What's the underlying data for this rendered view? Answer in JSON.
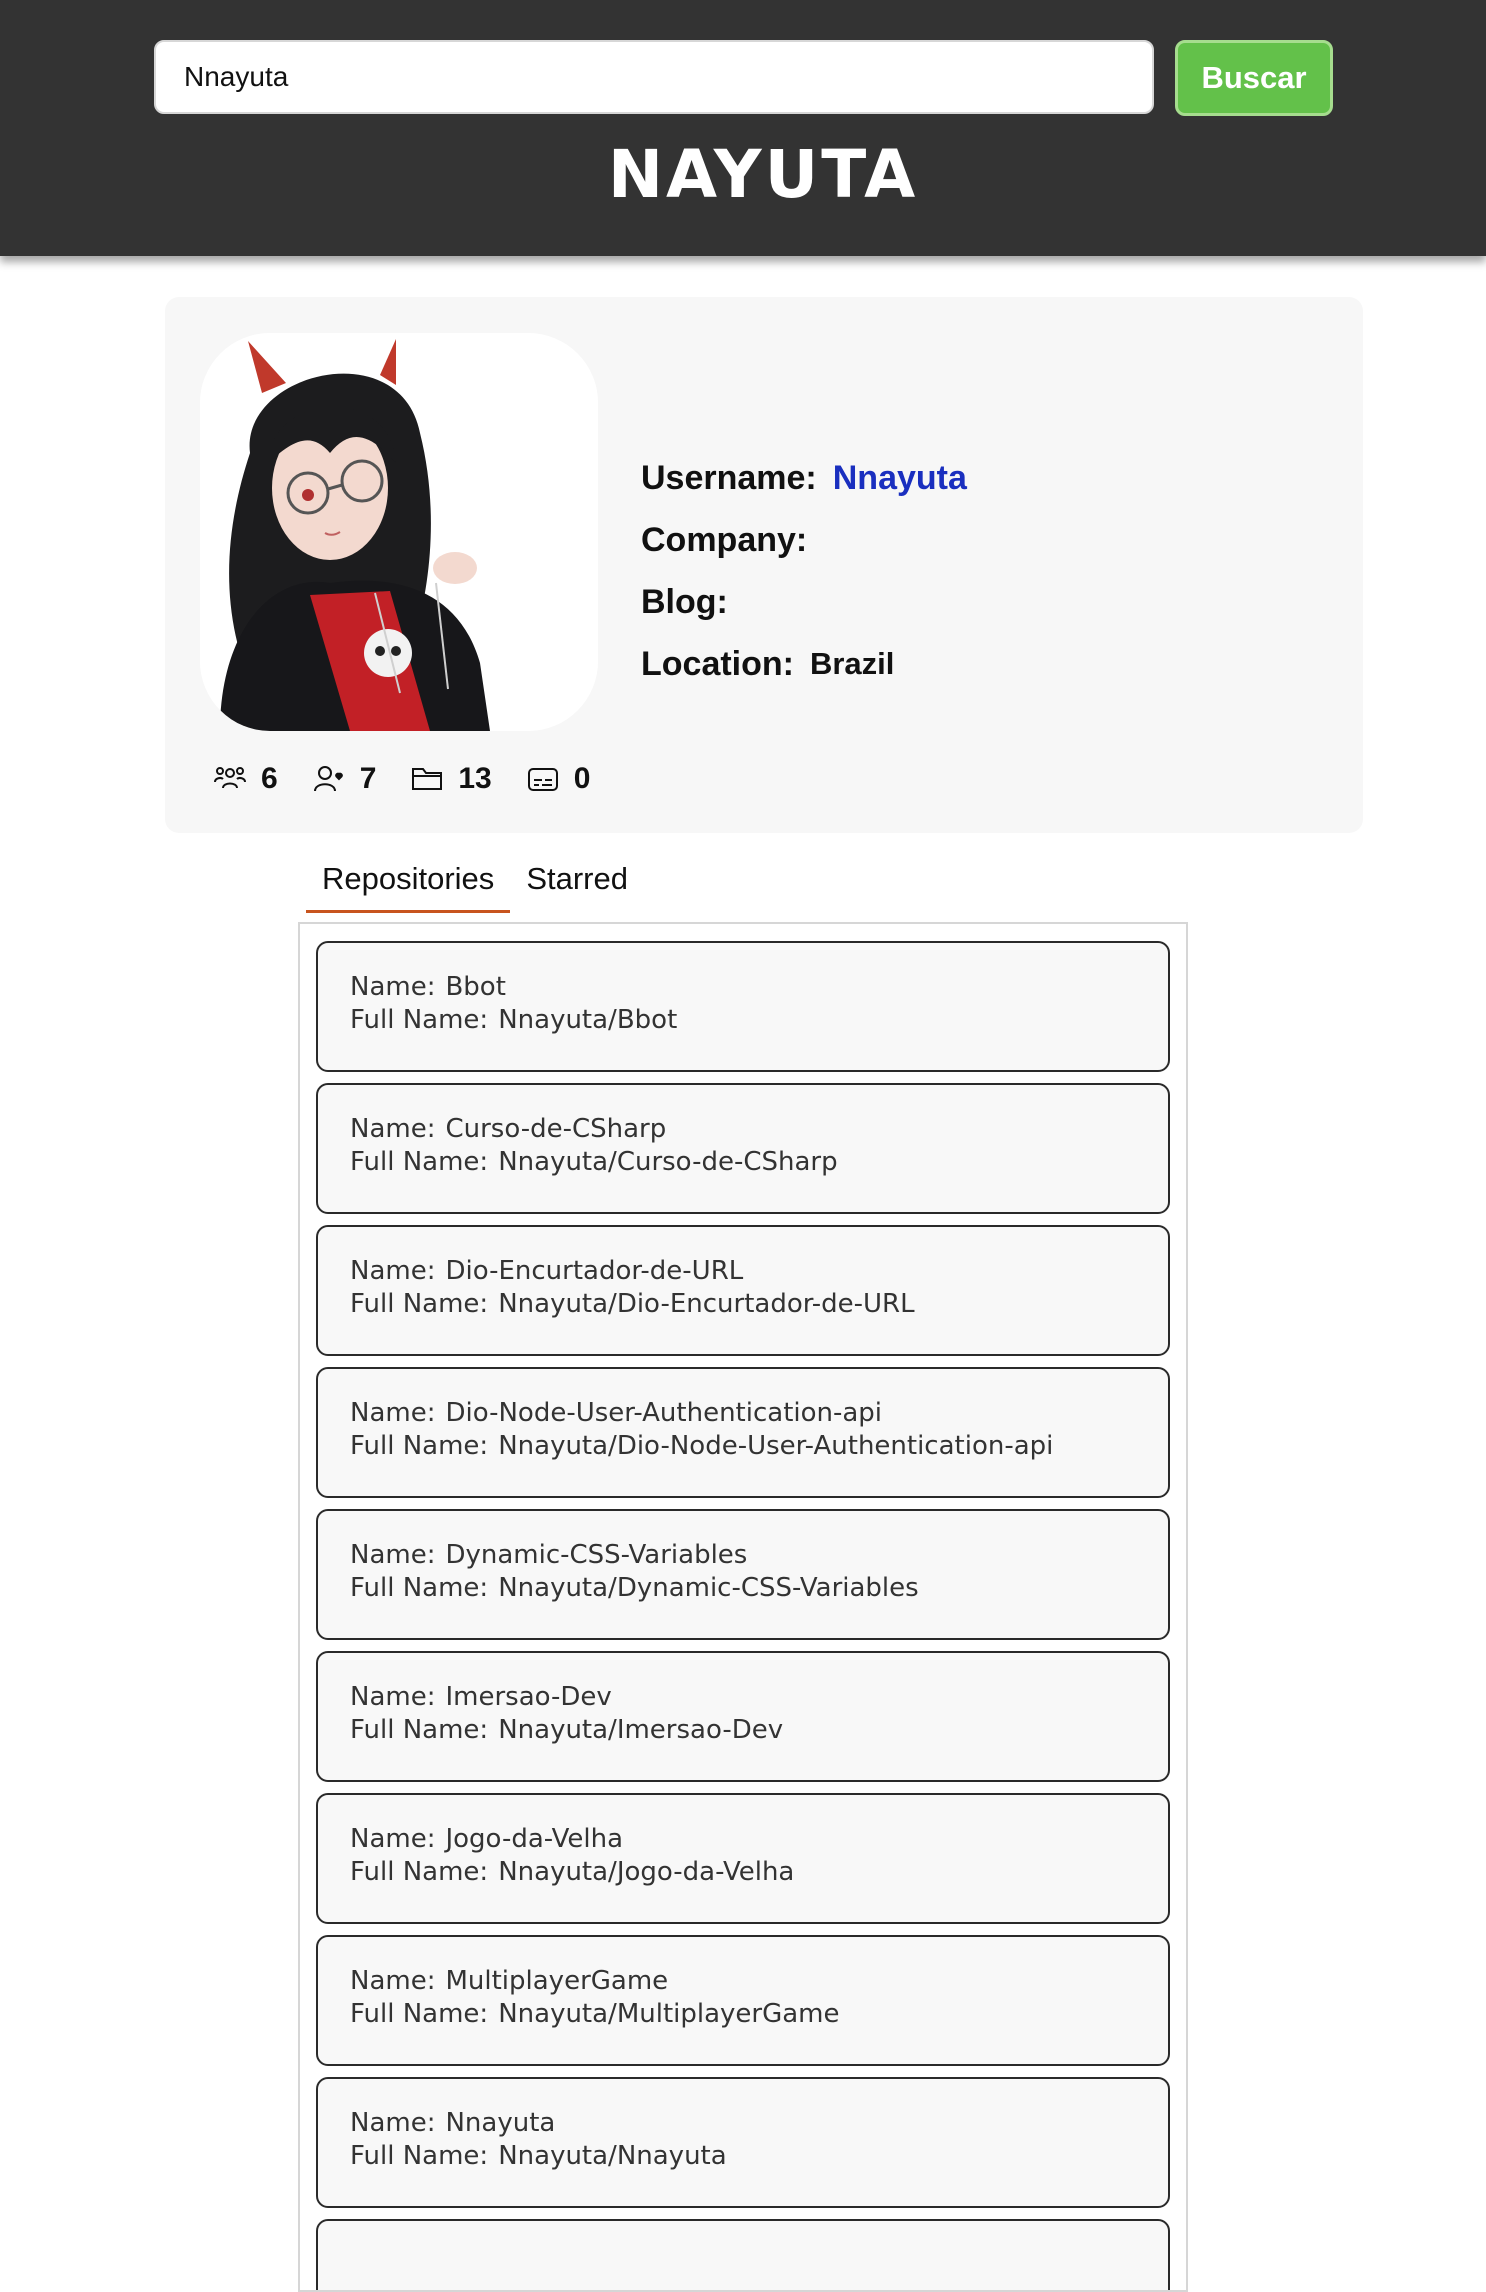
{
  "search": {
    "value": "Nnayuta",
    "button_label": "Buscar"
  },
  "header": {
    "logo": "NAYUTA"
  },
  "profile": {
    "username_label": "Username:",
    "username": "Nnayuta",
    "company_label": "Company:",
    "company": "",
    "blog_label": "Blog:",
    "blog": "",
    "location_label": "Location:",
    "location": "Brazil",
    "stats": [
      {
        "icon": "followers-icon",
        "value": "6"
      },
      {
        "icon": "following-icon",
        "value": "7"
      },
      {
        "icon": "repos-folder-icon",
        "value": "13"
      },
      {
        "icon": "gists-icon",
        "value": "0"
      }
    ]
  },
  "tabs": [
    {
      "label": "Repositories",
      "active": true
    },
    {
      "label": "Starred",
      "active": false
    }
  ],
  "repo_labels": {
    "name": "Name:",
    "full_name": "Full Name:"
  },
  "repos": [
    {
      "name": "Bbot",
      "full_name": "Nnayuta/Bbot"
    },
    {
      "name": "Curso-de-CSharp",
      "full_name": "Nnayuta/Curso-de-CSharp"
    },
    {
      "name": "Dio-Encurtador-de-URL",
      "full_name": "Nnayuta/Dio-Encurtador-de-URL"
    },
    {
      "name": "Dio-Node-User-Authentication-api",
      "full_name": "Nnayuta/Dio-Node-User-Authentication-api"
    },
    {
      "name": "Dynamic-CSS-Variables",
      "full_name": "Nnayuta/Dynamic-CSS-Variables"
    },
    {
      "name": "Imersao-Dev",
      "full_name": "Nnayuta/Imersao-Dev"
    },
    {
      "name": "Jogo-da-Velha",
      "full_name": "Nnayuta/Jogo-da-Velha"
    },
    {
      "name": "MultiplayerGame",
      "full_name": "Nnayuta/MultiplayerGame"
    },
    {
      "name": "Nnayuta",
      "full_name": "Nnayuta/Nnayuta"
    },
    {
      "name": "",
      "full_name": ""
    }
  ],
  "colors": {
    "header_bg": "#333333",
    "button_green": "#63c14a",
    "link_blue": "#1a2fbf",
    "tab_underline": "#c8541e"
  }
}
